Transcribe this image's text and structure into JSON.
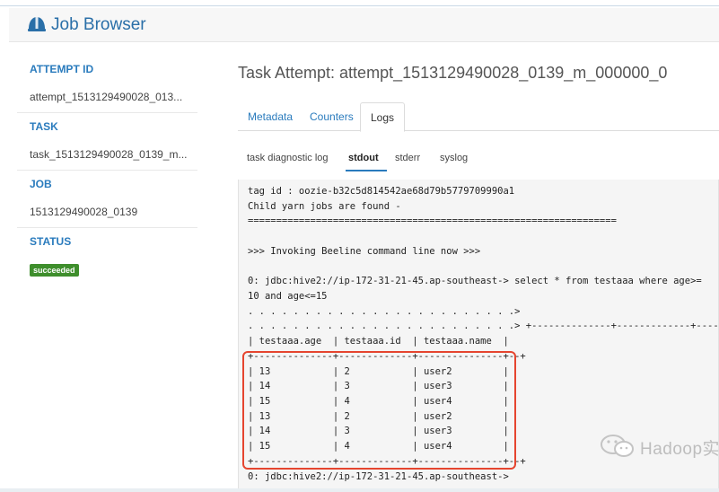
{
  "header": {
    "app_title": "Job Browser",
    "logo_icon": "hue-hardhat-icon",
    "accent": "#2a6fa8"
  },
  "sidebar": {
    "sections": [
      {
        "label": "ATTEMPT ID",
        "value": "attempt_1513129490028_013..."
      },
      {
        "label": "TASK",
        "value": "task_1513129490028_0139_m..."
      },
      {
        "label": "JOB",
        "value": "1513129490028_0139"
      },
      {
        "label": "STATUS",
        "value": "succeeded"
      }
    ],
    "status_color": "#3e8e2c"
  },
  "main": {
    "title": "Task Attempt: attempt_1513129490028_0139_m_000000_0",
    "tabs": [
      {
        "label": "Metadata",
        "active": false
      },
      {
        "label": "Counters",
        "active": false
      },
      {
        "label": "Logs",
        "active": true
      }
    ],
    "log_tabs": [
      {
        "label": "task diagnostic log",
        "active": false
      },
      {
        "label": "stdout",
        "active": true
      },
      {
        "label": "stderr",
        "active": false
      },
      {
        "label": "syslog",
        "active": false
      }
    ]
  },
  "log": {
    "lines": [
      "tag id : oozie-b32c5d814542ae68d79b5779709990a1",
      "Child yarn jobs are found -",
      "=================================================================",
      "",
      ">>> Invoking Beeline command line now >>>",
      "",
      "0: jdbc:hive2://ip-172-31-21-45.ap-southeast-> select * from testaaa where age>=",
      "10 and age<=15",
      ". . . . . . . . . . . . . . . . . . . . . . . .>",
      ". . . . . . . . . . . . . . . . . . . . . . . .> +--------------+-------------+--------------",
      "| testaaa.age  | testaaa.id  | testaaa.name  |",
      "+--------------+-------------+---------------+--+",
      "| 13           | 2           | user2         |",
      "| 14           | 3           | user3         |",
      "| 15           | 4           | user4         |",
      "| 13           | 2           | user2         |",
      "| 14           | 3           | user3         |",
      "| 15           | 4           | user4         |",
      "+--------------+-------------+---------------+--+",
      "0: jdbc:hive2://ip-172-31-21-45.ap-southeast->"
    ],
    "highlight_color": "#e5452f"
  },
  "watermark": {
    "text": "Hadoop实",
    "icon": "wechat-icon"
  }
}
